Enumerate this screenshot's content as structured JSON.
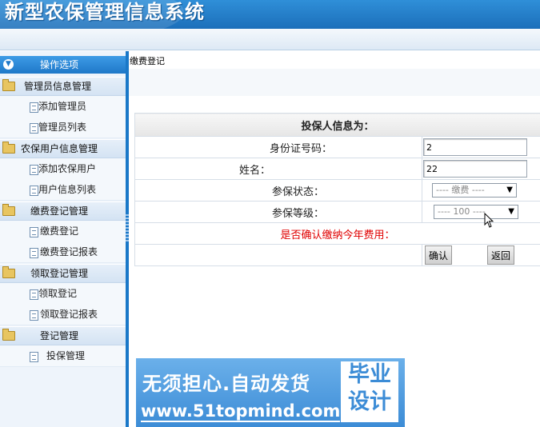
{
  "header": {
    "title": "新型农保管理信息系统"
  },
  "sidebar": {
    "top_label": "操作选项",
    "groups": [
      {
        "label": "管理员信息管理",
        "items": [
          {
            "label": "添加管理员"
          },
          {
            "label": "管理员列表"
          }
        ]
      },
      {
        "label": "农保用户信息管理",
        "items": [
          {
            "label": "添加农保用户"
          },
          {
            "label": "用户信息列表"
          }
        ]
      },
      {
        "label": "缴费登记管理",
        "items": [
          {
            "label": "缴费登记"
          },
          {
            "label": "缴费登记报表"
          }
        ]
      },
      {
        "label": "领取登记管理",
        "items": [
          {
            "label": "领取登记"
          },
          {
            "label": "领取登记报表"
          }
        ]
      },
      {
        "label": "登记管理",
        "items": [
          {
            "label": "投保管理"
          }
        ]
      }
    ]
  },
  "main": {
    "breadcrumb": "缴费登记",
    "form": {
      "heading": "投保人信息为：",
      "fields": {
        "id_label": "身份证号码：",
        "id_value": "2",
        "name_label": "姓名：",
        "name_value": "22",
        "status_label": "参保状态：",
        "status_value": "---- 缴费 ----",
        "level_label": "参保等级：",
        "level_value": "---- 100 ----"
      },
      "confirm_text": "是否确认缴纳今年费用：",
      "confirm_button": "确认",
      "back_button": "返回"
    }
  },
  "banner": {
    "line1": "无须担心.自动发货",
    "line2": "www.51topmind.com",
    "stamp": "毕业设计"
  },
  "colors": {
    "header_blue": "#1c6fba",
    "accent_red": "#e00000",
    "sidebar_edge": "#1a78c8"
  }
}
